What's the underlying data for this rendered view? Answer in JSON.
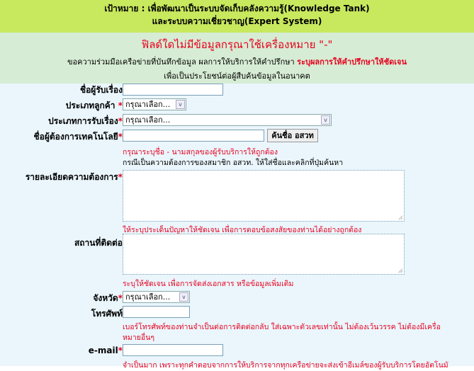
{
  "banner": {
    "line1": "เป้าหมาย : เพื่อพัฒนาเป็นระบบจัดเก็บคลังความรู้(Knowledge Tank)",
    "line2": "และระบบความเชี่ยวชาญ(Expert System)"
  },
  "notice": {
    "title": "ฟิลด์ใดไม่มีข้อมูลกรุณาใช้เครื่องหมาย \"-\"",
    "line2_prefix": "ขอความร่วมมือเครือข่ายที่บันทึกข้อมูล ผลการให้บริการให้คำปรึกษา",
    "line2_red": "ระบุผลการให้คำปรึกษาให้ชัดเจน",
    "line3": "เพื่อเป็นประโยชน์ต่อผู้สืบค้นข้อมูลในอนาคต"
  },
  "form": {
    "receiver_label": "ชื่อผู้รับเรื่อง",
    "customer_type_label": "ประเภทลูกค้า",
    "customer_type_value": "กรุณาเลือก...",
    "receive_type_label": "ประเภทการรับเรื่อง",
    "receive_type_value": "กรุณาเลือก...",
    "tech_requester_label": "ชื่อผู้ต้องการเทคโนโลยี",
    "search_button": "ค้นชื่อ อสวท",
    "tech_hint1": "กรุณาระบุชื่อ - นามสกุลของผู้รับบริการให้ถูกต้อง",
    "tech_hint2": "กรณีเป็นความต้องการของสมาชิก อสวท. ให้ใส่ชื่อและคลิกที่ปุ่มค้นหา",
    "details_label": "รายละเอียดความต้องการ",
    "details_hint": "ให้ระบุประเด็นปัญหาให้ชัดเจน เพื่อการตอบข้อสงสัยของท่านได้อย่างถูกต้อง",
    "address_label": "สถานที่ติดต่อ",
    "address_hint": "ระบุให้ชัดเจน เพื่อการจัดส่งเอกสาร หรือข้อมูลเพิ่มเติม",
    "province_label": "จังหวัด",
    "province_value": "กรุณาเลือก...",
    "phone_label": "โทรศัพท์",
    "phone_hint1": "เบอร์โทรศัพท์ของท่านจำเป็นต่อการติดต่อกลับ ใส่เฉพาะตัวเลขเท่านั้น ไม่ต้องเว้นวรรค ไม่ต้องมีเครื่อ",
    "phone_hint2": "หมายอื่นๆ",
    "email_label": "e-mail",
    "email_hint": "จำเป็นมาก เพราะทุกคำตอบจากการให้บริการจากทุกเครือข่ายจะส่งเข้าอีเมล์ของผู้รับบริการโดยอัตโนมั",
    "required_mark": "*",
    "dropdown_arrow": "v"
  }
}
